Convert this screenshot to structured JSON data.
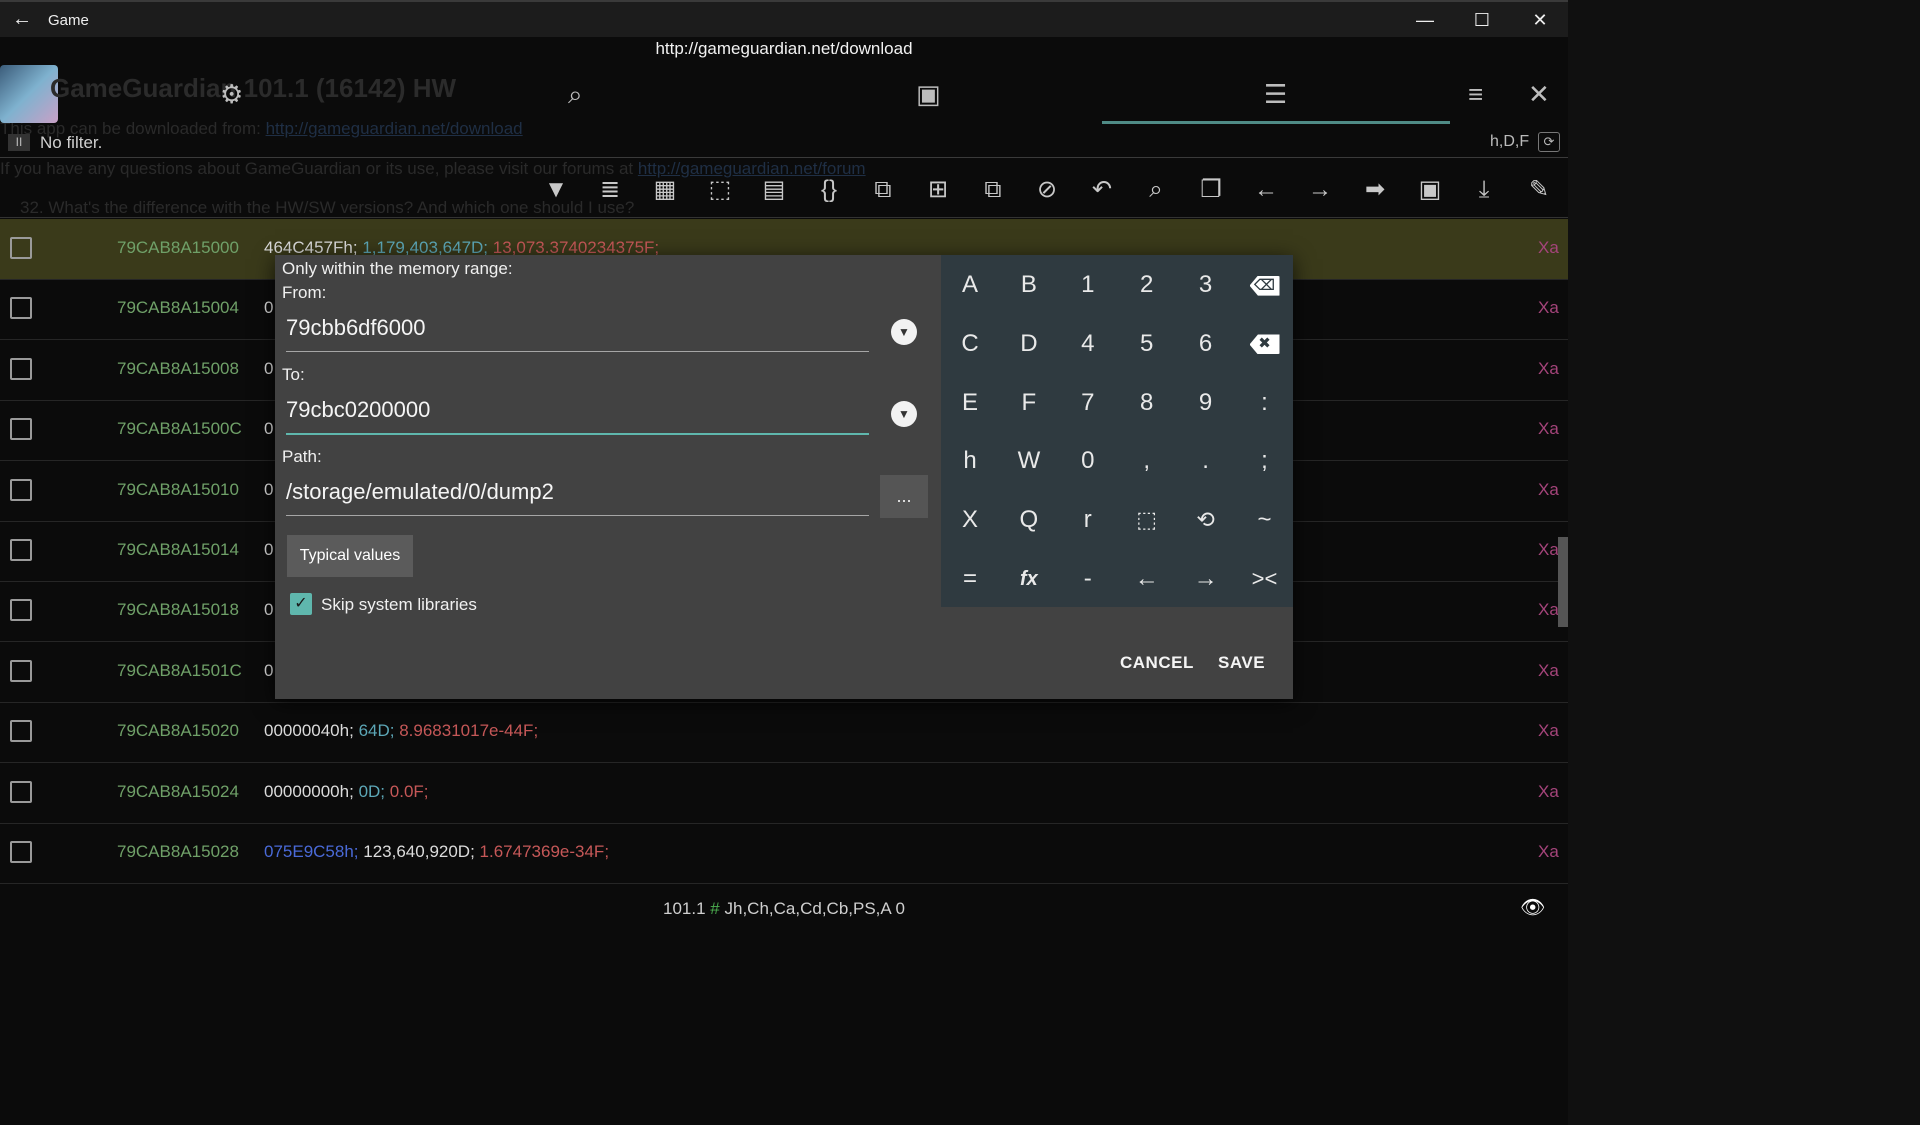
{
  "window": {
    "title": "Game",
    "back_icon": "←",
    "minimize": "—",
    "maximize": "☐",
    "close": "✕"
  },
  "url": "http://gameguardian.net/download",
  "app": {
    "name": "GameGuardian 101.1 (16142) HW",
    "no_filter": "No filter.",
    "pause": "II",
    "flags": "h,D,F",
    "refresh_icon": "⟳"
  },
  "background_text": [
    {
      "text": "This app can be downloaded from: ",
      "link": "http://gameguardian.net/download"
    },
    {
      "text": "If you have any questions about GameGuardian or its use, please visit our forums at ",
      "link": "http://gameguardian.net/forum"
    },
    {
      "text": "32. What's the difference with the HW/SW versions? And which one should I use?",
      "link": ""
    }
  ],
  "rows": [
    {
      "address": "79CAB8A15000",
      "hex": "464C457Fh;",
      "dword": "1,179,403,647D;",
      "float": "13,073.3740234375F;",
      "suffix": "Xa",
      "highlight": true
    },
    {
      "address": "79CAB8A15004",
      "hex": "0",
      "dword": "",
      "float": "",
      "suffix": "Xa",
      "highlight": false
    },
    {
      "address": "79CAB8A15008",
      "hex": "0",
      "dword": "",
      "float": "",
      "suffix": "Xa",
      "highlight": false
    },
    {
      "address": "79CAB8A1500C",
      "hex": "0",
      "dword": "",
      "float": "",
      "suffix": "Xa",
      "highlight": false
    },
    {
      "address": "79CAB8A15010",
      "hex": "0",
      "dword": "",
      "float": "",
      "suffix": "Xa",
      "highlight": false
    },
    {
      "address": "79CAB8A15014",
      "hex": "0",
      "dword": "",
      "float": "",
      "suffix": "Xa",
      "highlight": false
    },
    {
      "address": "79CAB8A15018",
      "hex": "0",
      "dword": "",
      "float": "",
      "suffix": "Xa",
      "highlight": false
    },
    {
      "address": "79CAB8A1501C",
      "hex": "0",
      "dword": "",
      "float": "",
      "suffix": "Xa",
      "highlight": false
    },
    {
      "address": "79CAB8A15020",
      "hex": "00000040h;",
      "dword": "64D;",
      "float": "8.96831017e-44F;",
      "suffix": "Xa",
      "highlight": false
    },
    {
      "address": "79CAB8A15024",
      "hex": "00000000h;",
      "dword": "0D;",
      "float": "0.0F;",
      "suffix": "Xa",
      "highlight": false
    },
    {
      "address": "79CAB8A15028",
      "hex": "075E9C58h;",
      "dword": "123,640,920D;",
      "float": "1.6747369e-34F;",
      "suffix": "Xa",
      "highlight": false
    }
  ],
  "bottom": {
    "version": "101.1",
    "hash": "#",
    "regions": "Jh,Ch,Ca,Cd,Cb,PS,A 0",
    "eye_icon": "👁"
  },
  "dialog": {
    "heading": "Only within the memory range:",
    "from_label": "From:",
    "from_value": "79cbb6df6000",
    "to_label": "To:",
    "to_value": "79cbc0200000",
    "path_label": "Path:",
    "path_value": "/storage/emulated/0/dump2",
    "dots": "...",
    "dropdown_icon": "▼",
    "typical_values": "Typical values",
    "skip_label": "Skip system libraries",
    "check_mark": "✓",
    "cancel": "CANCEL",
    "save": "SAVE"
  },
  "keypad": [
    [
      "A",
      "B",
      "1",
      "2",
      "3",
      "⌫"
    ],
    [
      "C",
      "D",
      "4",
      "5",
      "6",
      "✖"
    ],
    [
      "E",
      "F",
      "7",
      "8",
      "9",
      ":"
    ],
    [
      "h",
      "W",
      "0",
      ",",
      ".",
      ";"
    ],
    [
      "X",
      "Q",
      "r",
      "⬚",
      "⟲",
      "~"
    ],
    [
      "=",
      "fx",
      "-",
      "←",
      "→",
      "><"
    ]
  ],
  "colors": {
    "accent": "#5fb7ad",
    "address": "#6fa068",
    "xa": "#a4447a",
    "float": "#c65858",
    "dword": "#5da8b8"
  }
}
